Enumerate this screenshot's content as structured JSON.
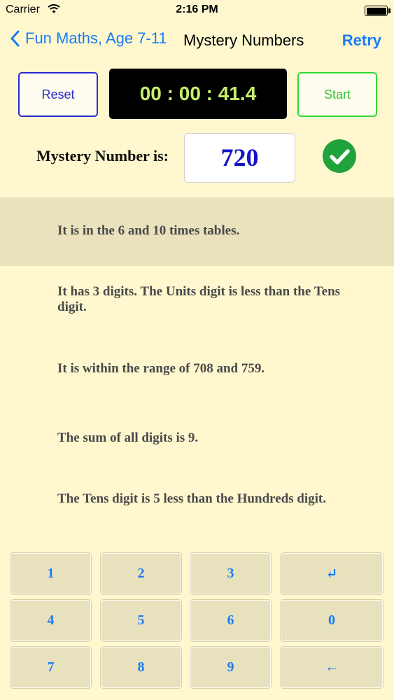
{
  "status_bar": {
    "carrier": "Carrier",
    "time": "2:16 PM"
  },
  "nav": {
    "back_label": "Fun Maths, Age 7-11",
    "title": "Mystery Numbers",
    "retry_label": "Retry"
  },
  "controls": {
    "reset_label": "Reset",
    "timer": "00 : 00 : 41.4",
    "start_label": "Start"
  },
  "mystery": {
    "label": "Mystery Number is:",
    "value": "720"
  },
  "clues": [
    "It is in the 6 and 10 times tables.",
    "It has 3 digits.  The Units digit is less than the Tens digit.",
    "It is within the range of 708 and 759.",
    "The sum of all digits is 9.",
    "The Tens digit is 5 less than the Hundreds digit."
  ],
  "keypad": [
    "1",
    "2",
    "3",
    "↵",
    "4",
    "5",
    "6",
    "0",
    "7",
    "8",
    "9",
    "←"
  ],
  "colors": {
    "background": "#fff8cf",
    "accent": "#1a7cf5",
    "timer_text": "#c6f06a",
    "check": "#1fa33a"
  }
}
